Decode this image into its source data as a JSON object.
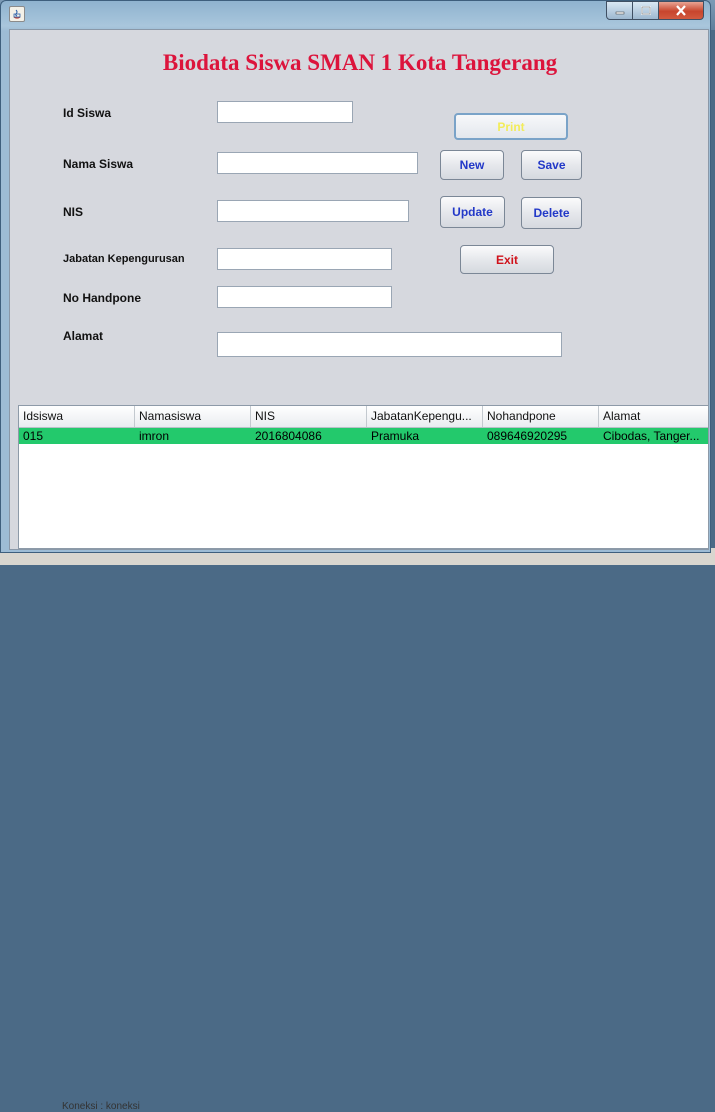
{
  "window": {
    "title": "",
    "controls": {
      "minimize": "minimize",
      "maximize": "maximize",
      "close": "close"
    }
  },
  "form": {
    "heading": "Biodata Siswa SMAN 1 Kota Tangerang",
    "fields": [
      {
        "label": "Id Siswa",
        "value": ""
      },
      {
        "label": "Nama Siswa",
        "value": ""
      },
      {
        "label": "NIS",
        "value": ""
      },
      {
        "label": "Jabatan Kepengurusan",
        "value": ""
      },
      {
        "label": "No Handpone",
        "value": ""
      },
      {
        "label": "Alamat",
        "value": ""
      }
    ]
  },
  "buttons": {
    "print": "Print",
    "new": "New",
    "save": "Save",
    "update": "Update",
    "delete": "Delete",
    "exit": "Exit"
  },
  "table": {
    "columns": [
      "Idsiswa",
      "Namasiswa",
      "NIS",
      "JabatanKepengu...",
      "Nohandpone",
      "Alamat"
    ],
    "rows": [
      [
        "015",
        "imron",
        "2016804086",
        "Pramuka",
        "089646920295",
        "Cibodas, Tanger..."
      ]
    ]
  },
  "background": {
    "taskbar_text": "Koneksi : koneksi"
  },
  "colors": {
    "heading": "#dc143c",
    "selected_row": "#23c96c",
    "button_blue_text": "#2238c8",
    "button_red_text": "#d0121b",
    "print_text": "#f2ec5a"
  }
}
